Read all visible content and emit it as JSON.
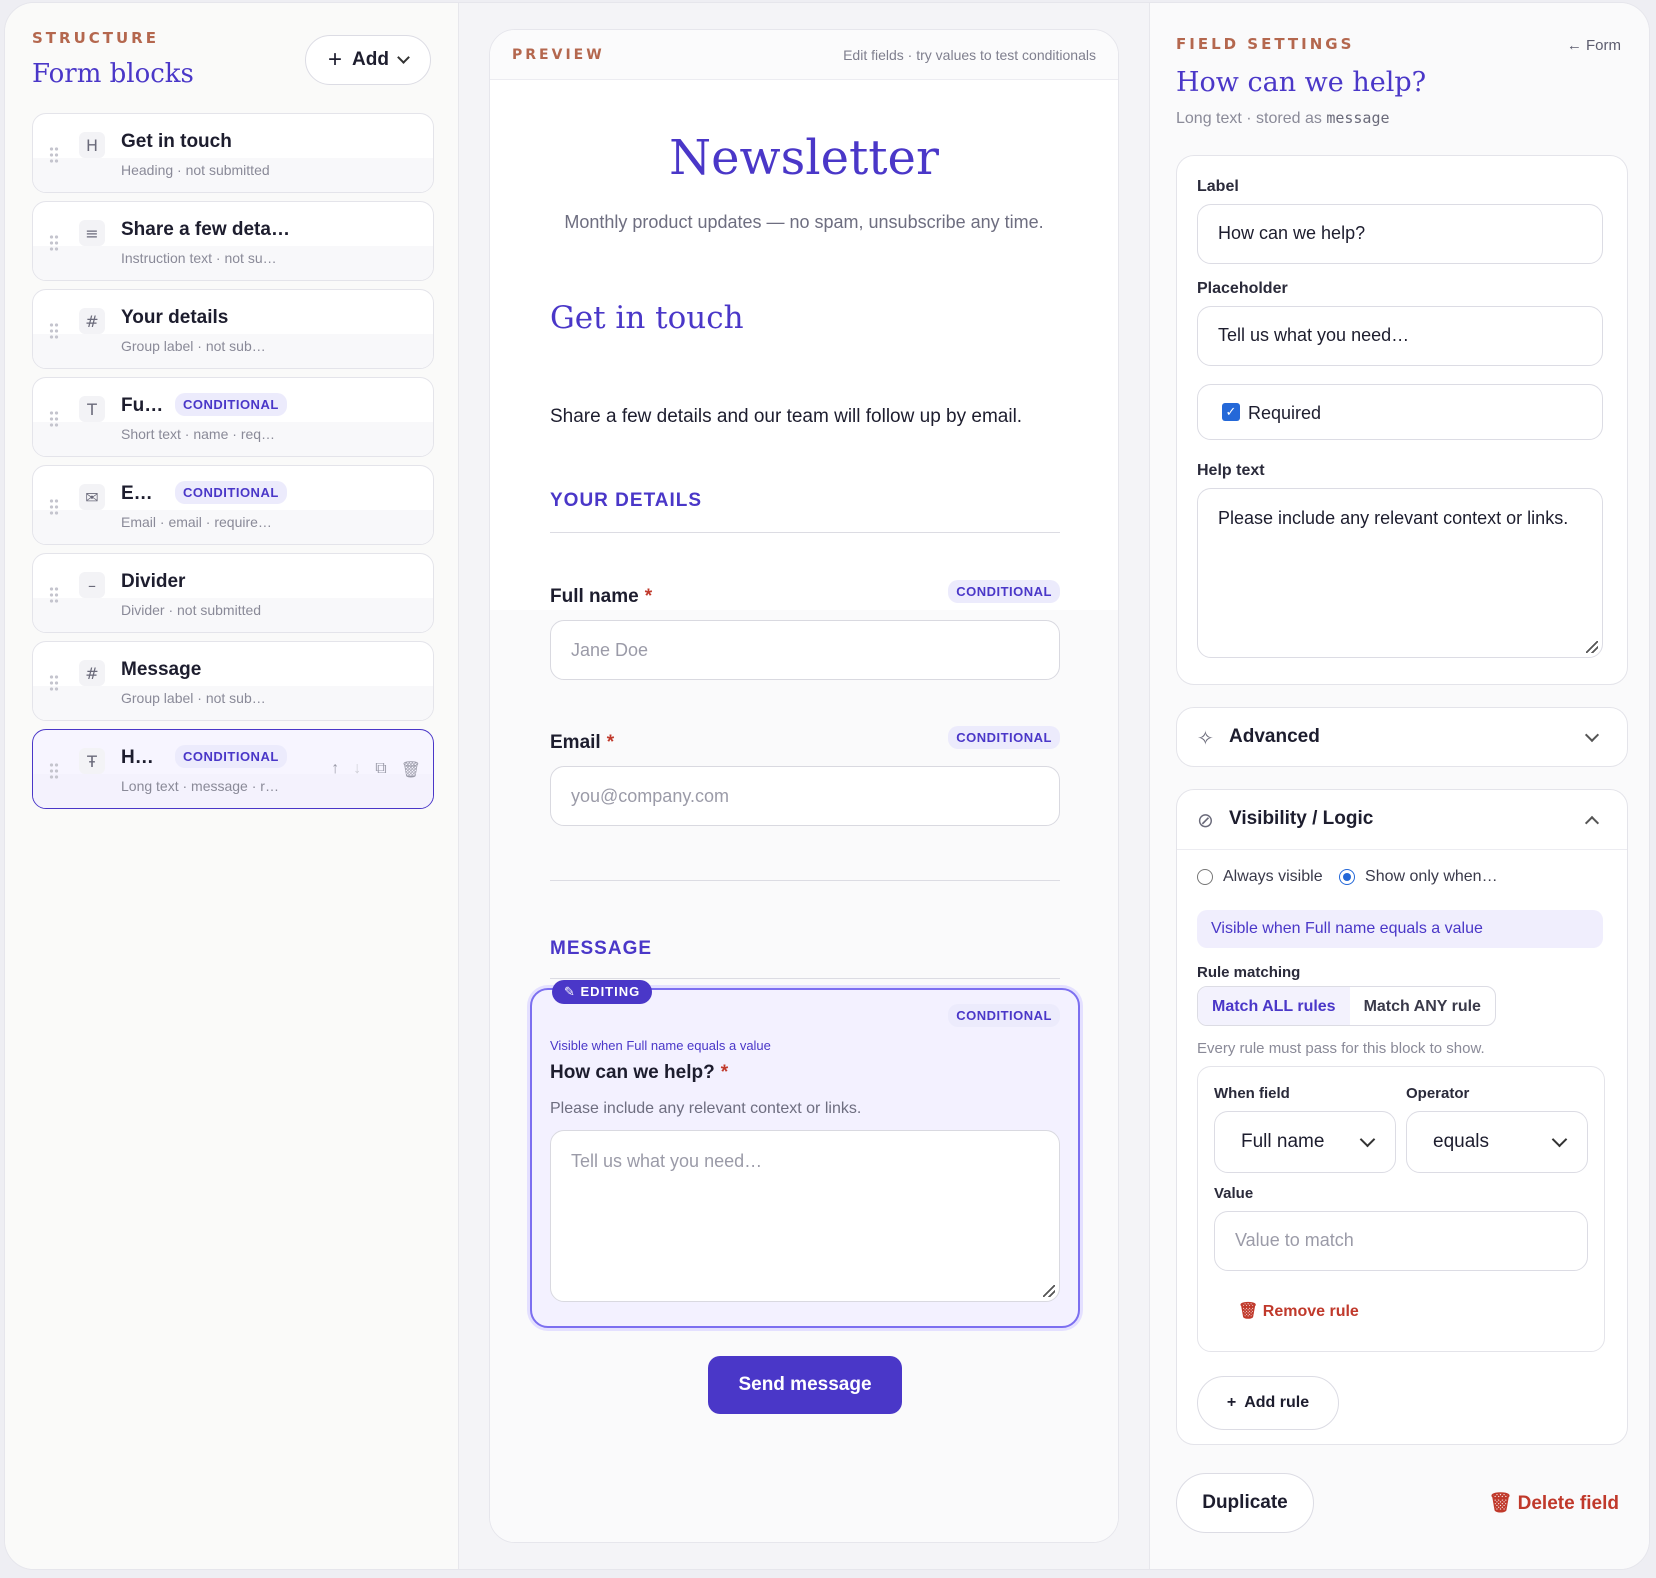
{
  "structure": {
    "eyebrow": "STRUCTURE",
    "title": "Form blocks",
    "add_label": "Add",
    "blocks": [
      {
        "icon": "H",
        "title": "Get in touch",
        "subtitle": "Heading · not submitted",
        "badge": ""
      },
      {
        "icon": "≡",
        "title": "Share a few deta…",
        "subtitle": "Instruction text · not su…",
        "badge": ""
      },
      {
        "icon": "#",
        "title": "Your details",
        "subtitle": "Group label · not sub…",
        "badge": ""
      },
      {
        "icon": "T",
        "title": "Fu…",
        "subtitle": "Short text · name · req…",
        "badge": "CONDITIONAL"
      },
      {
        "icon": "✉",
        "title": "E…",
        "subtitle": "Email · email · require…",
        "badge": "CONDITIONAL"
      },
      {
        "icon": "–",
        "title": "Divider",
        "subtitle": "Divider · not submitted",
        "badge": ""
      },
      {
        "icon": "#",
        "title": "Message",
        "subtitle": "Group label · not sub…",
        "badge": ""
      },
      {
        "icon": "Ŧ",
        "title": "H…",
        "subtitle": "Long text · message · r…",
        "badge": "CONDITIONAL"
      }
    ]
  },
  "preview": {
    "eyebrow": "PREVIEW",
    "hint": "Edit fields · try values to test conditionals",
    "form_title": "Newsletter",
    "form_subtitle": "Monthly product updates — no spam, unsubscribe any time.",
    "heading": "Get in touch",
    "instruction": "Share a few details and our team will follow up by email.",
    "group1": "YOUR DETAILS",
    "group2": "MESSAGE",
    "badge": "CONDITIONAL",
    "full_name": {
      "label": "Full name",
      "placeholder": "Jane Doe"
    },
    "email": {
      "label": "Email",
      "placeholder": "you@company.com"
    },
    "editing_tag": "EDITING",
    "message": {
      "visibility": "Visible when Full name equals a value",
      "label": "How can we help?",
      "help": "Please include any relevant context or links.",
      "placeholder": "Tell us what you need…"
    },
    "required_mark": "*",
    "submit": "Send message"
  },
  "settings": {
    "eyebrow": "FIELD SETTINGS",
    "back": "Form",
    "title": "How can we help?",
    "subtitle_prefix": "Long text · stored as",
    "subtitle_key": "message",
    "label_label": "Label",
    "label_value": "How can we help?",
    "placeholder_label": "Placeholder",
    "placeholder_value": "Tell us what you need…",
    "required_label": "Required",
    "help_label": "Help text",
    "help_value": "Please include any relevant context or links.",
    "advanced": "Advanced",
    "visibility": "Visibility / Logic",
    "always_visible": "Always visible",
    "show_only_when": "Show only when…",
    "visibility_summary": "Visible when Full name equals a value",
    "rule_matching": "Rule matching",
    "match_all": "Match ALL rules",
    "match_any": "Match ANY rule",
    "rule_note": "Every rule must pass for this block to show.",
    "when_field_label": "When field",
    "when_field_value": "Full name",
    "operator_label": "Operator",
    "operator_value": "equals",
    "value_label": "Value",
    "value_placeholder": "Value to match",
    "remove_rule": "Remove rule",
    "add_rule": "Add rule",
    "duplicate": "Duplicate",
    "delete": "Delete field"
  }
}
